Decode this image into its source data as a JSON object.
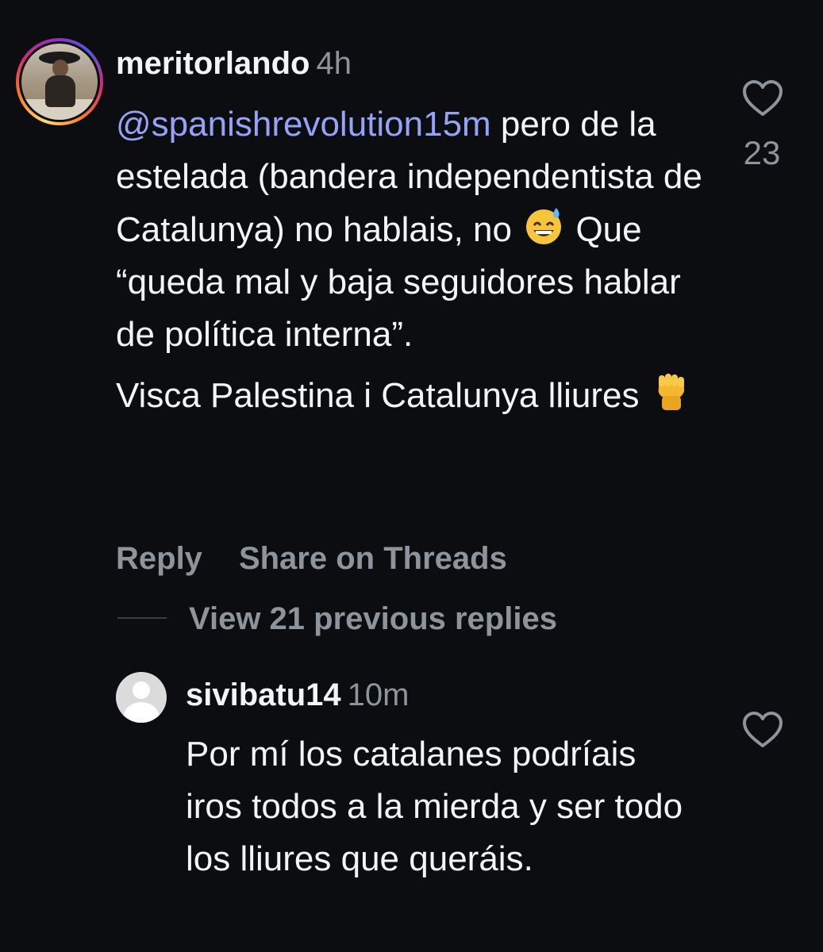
{
  "comment": {
    "username": "meritorlando",
    "timestamp": "4h",
    "mention": "@spanishrevolution15m",
    "text_part1": " pero de la estelada (bandera independentista de Catalunya) no hablais, no ",
    "emoji1": "😅",
    "text_part2": " Que “queda mal y baja seguidores hablar de política interna”.",
    "text_part3": "Visca Palestina i Catalunya lliures ",
    "emoji2": "✊",
    "like_count": "23",
    "reply_label": "Reply",
    "share_label": "Share on Threads",
    "view_replies_label": "View 21 previous replies"
  },
  "reply": {
    "username": "sivibatu14",
    "timestamp": "10m",
    "text": "Por mí los catalanes podríais iros todos a la mierda y ser todo los lliures que queráis."
  },
  "icons": {
    "like": "heart-outline-icon",
    "avatar_placeholder": "default-avatar-icon"
  },
  "colors": {
    "background": "#0b0d10",
    "text": "#f2f4f6",
    "muted": "#8d949c",
    "mention": "#95a3f7"
  }
}
